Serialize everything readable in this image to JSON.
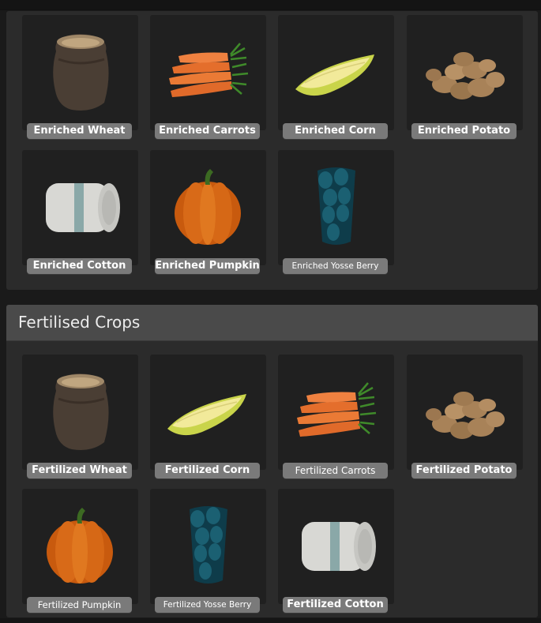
{
  "enriched_items": [
    {
      "label": "Enriched Wheat",
      "icon": "wheat-sack-icon"
    },
    {
      "label": "Enriched Carrots",
      "icon": "carrots-icon"
    },
    {
      "label": "Enriched Corn",
      "icon": "corn-icon"
    },
    {
      "label": "Enriched Potato",
      "icon": "potato-icon"
    },
    {
      "label": "Enriched Cotton",
      "icon": "cotton-bale-icon"
    },
    {
      "label": "Enriched Pumpkin",
      "icon": "pumpkin-icon"
    },
    {
      "label": "Enriched Yosse Berry",
      "icon": "yosse-berry-icon"
    }
  ],
  "fertilised_section": {
    "title": "Fertilised Crops"
  },
  "fertilised_items": [
    {
      "label": "Fertilized Wheat",
      "icon": "wheat-sack-icon"
    },
    {
      "label": "Fertilized Corn",
      "icon": "corn-icon"
    },
    {
      "label": "Fertilized Carrots",
      "icon": "carrots-icon"
    },
    {
      "label": "Fertilized Potato",
      "icon": "potato-icon"
    },
    {
      "label": "Fertilized Pumpkin",
      "icon": "pumpkin-icon"
    },
    {
      "label": "Fertilized Yosse Berry",
      "icon": "yosse-berry-icon"
    },
    {
      "label": "Fertilized Cotton",
      "icon": "cotton-bale-icon"
    }
  ]
}
